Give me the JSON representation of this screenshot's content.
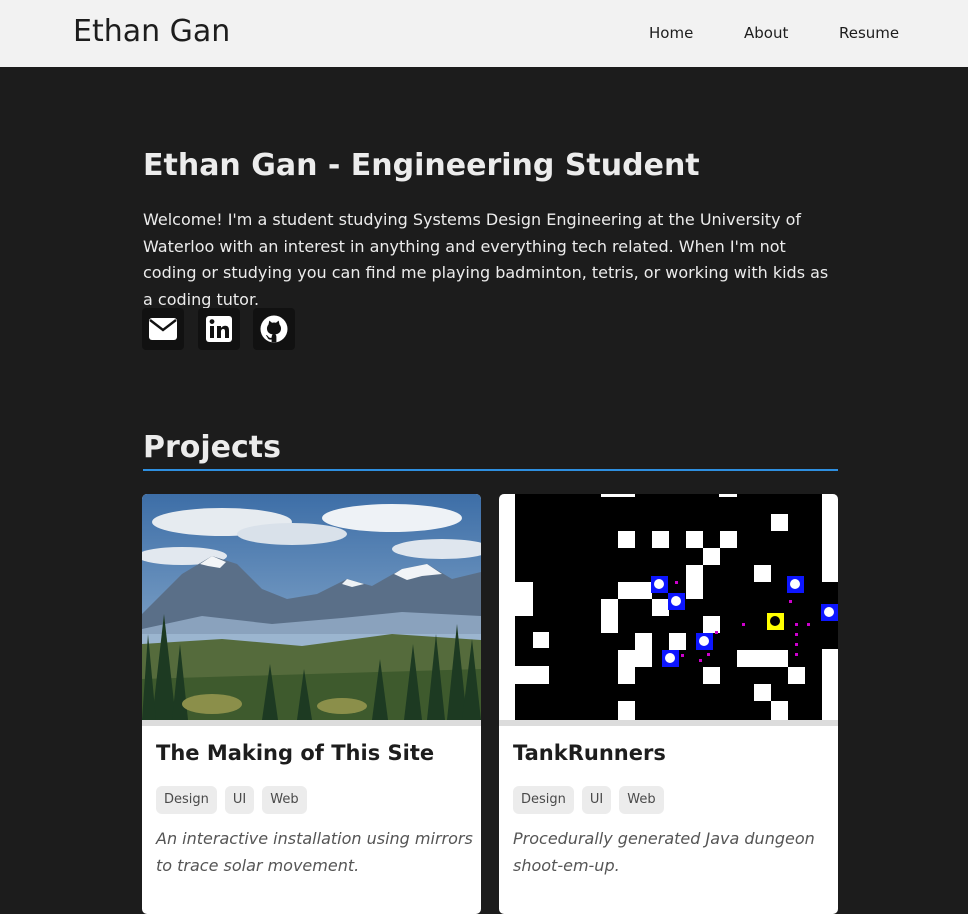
{
  "nav": {
    "brand": "Ethan Gan",
    "links": [
      "Home",
      "About",
      "Resume"
    ]
  },
  "hero": {
    "title": "Ethan Gan - Engineering Student",
    "intro": "Welcome! I'm a student studying Systems Design Engineering at the University of Waterloo with an interest in anything and everything tech related. When I'm not coding or studying you can find me playing badminton, tetris, or working with kids as a coding tutor.",
    "socials": [
      {
        "icon": "envelope-icon"
      },
      {
        "icon": "linkedin-icon"
      },
      {
        "icon": "github-icon"
      }
    ]
  },
  "projects": {
    "heading": "Projects",
    "accent_color": "#2e8fe0",
    "cards": [
      {
        "title": "The Making of This Site",
        "image": "mountain-landscape-image",
        "tags": [
          "Design",
          "UI",
          "Web"
        ],
        "description": "An interactive installation using mirrors to trace solar movement."
      },
      {
        "title": "TankRunners",
        "image": "pixel-game-screenshot",
        "tags": [
          "Design",
          "UI",
          "Web"
        ],
        "description": "Procedurally generated Java dungeon shoot-em-up."
      }
    ]
  },
  "colors": {
    "page_background": "#1c1c1c",
    "navbar_background": "#f2f2f2",
    "card_background": "#ffffff",
    "tag_background": "#ececec"
  }
}
